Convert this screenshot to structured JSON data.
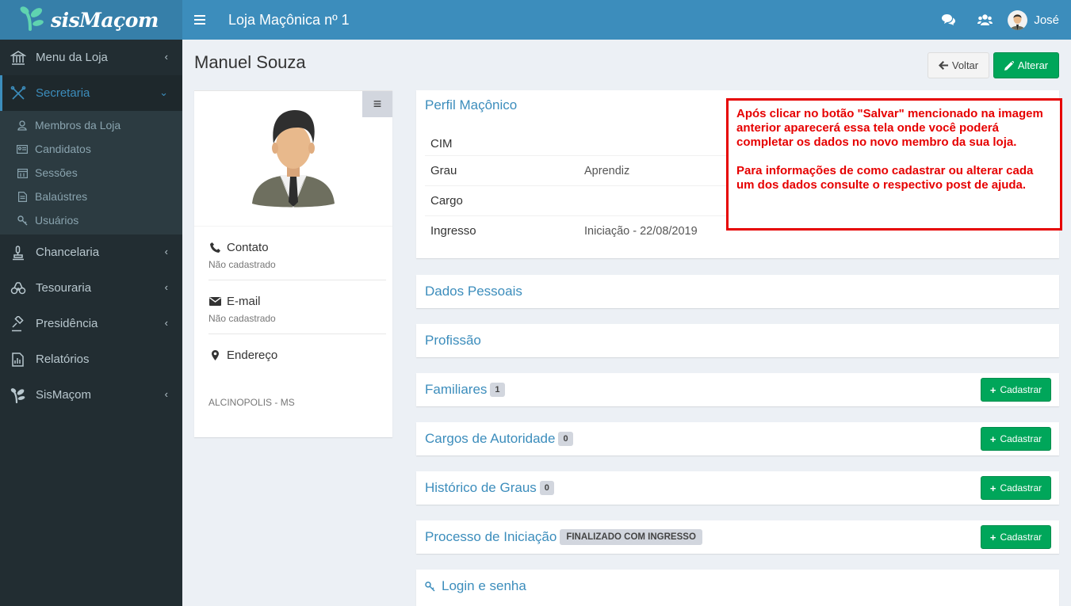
{
  "app": {
    "logo_text": "sisMaçom"
  },
  "header": {
    "title": "Loja Maçônica nº 1",
    "user_name": "José"
  },
  "sidebar": {
    "items": [
      {
        "label": "Menu da Loja"
      },
      {
        "label": "Secretaria"
      },
      {
        "label": "Chancelaria"
      },
      {
        "label": "Tesouraria"
      },
      {
        "label": "Presidência"
      },
      {
        "label": "Relatórios"
      },
      {
        "label": "SisMaçom"
      }
    ],
    "submenu": [
      {
        "label": "Membros da Loja"
      },
      {
        "label": "Candidatos"
      },
      {
        "label": "Sessões"
      },
      {
        "label": "Balaústres"
      },
      {
        "label": "Usuários"
      }
    ]
  },
  "page": {
    "title": "Manuel Souza",
    "voltar_label": "Voltar",
    "alterar_label": "Alterar"
  },
  "profile": {
    "contato_label": "Contato",
    "contato_value": "Não cadastrado",
    "email_label": "E-mail",
    "email_value": "Não cadastrado",
    "endereco_label": "Endereço",
    "endereco_value": "ALCINOPOLIS - MS"
  },
  "perfil": {
    "title": "Perfil Maçônico",
    "rows": [
      {
        "key": "CIM",
        "value": ""
      },
      {
        "key": "Grau",
        "value": "Aprendiz"
      },
      {
        "key": "Cargo",
        "value": ""
      },
      {
        "key": "Ingresso",
        "value": "Iniciação - 22/08/2019"
      }
    ]
  },
  "panels": {
    "dados_pessoais": "Dados Pessoais",
    "profissao": "Profissão",
    "familiares": {
      "title": "Familiares",
      "count": "1"
    },
    "cargos": {
      "title": "Cargos de Autoridade",
      "count": "0"
    },
    "historico": {
      "title": "Histórico de Graus",
      "count": "0"
    },
    "processo": {
      "title": "Processo de Iniciação",
      "status": "FINALIZADO COM INGRESSO"
    },
    "login": "Login e senha",
    "cadastrar_label": "Cadastrar"
  },
  "annotation": {
    "paragraph1": "Após clicar no botão \"Salvar\" mencionado na imagem anterior aparecerá essa tela onde você poderá completar os dados no novo membro da sua loja.",
    "paragraph2": "Para informações de como cadastrar ou alterar cada um dos dados consulte o respectivo post de ajuda."
  },
  "colors": {
    "header": "#3c8dbc",
    "logo_bg": "#367fa9",
    "sidebar": "#222d32",
    "success": "#00a65a",
    "annotation": "#e60000"
  }
}
